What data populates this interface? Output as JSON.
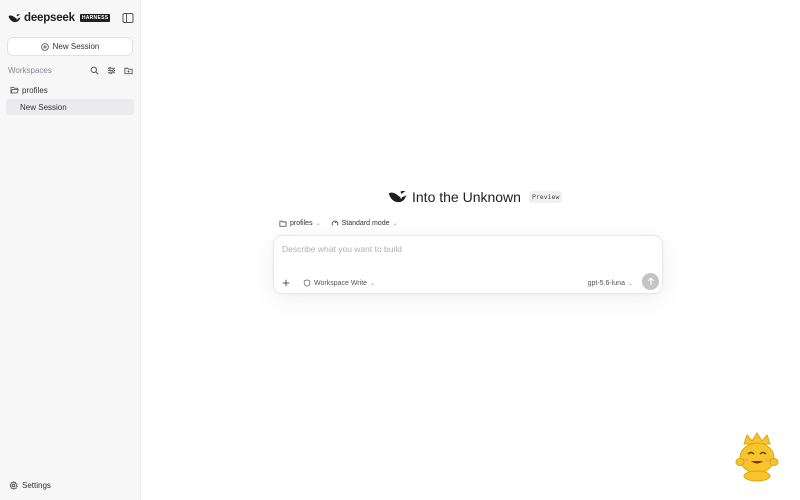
{
  "brand": {
    "name": "deepseek",
    "badge": "HARNESS"
  },
  "sidebar": {
    "new_session_label": "New Session",
    "workspaces_label": "Workspaces",
    "folder_name": "profiles",
    "sessions": [
      {
        "label": "New Session"
      }
    ],
    "settings_label": "Settings"
  },
  "main": {
    "hero_title": "Into the Unknown",
    "preview_badge": "Preview",
    "workspace_select": "profiles",
    "mode_select": "Standard mode",
    "composer": {
      "placeholder": "Describe what you want to build",
      "value": "",
      "permission": "Workspace Write",
      "model": "gpt-5.6-luna"
    }
  },
  "colors": {
    "sidebar_bg": "#f7f7f8",
    "accent": "#1f1f1f",
    "send_button": "#c3c3c8",
    "mascot": "#f7c52b"
  }
}
